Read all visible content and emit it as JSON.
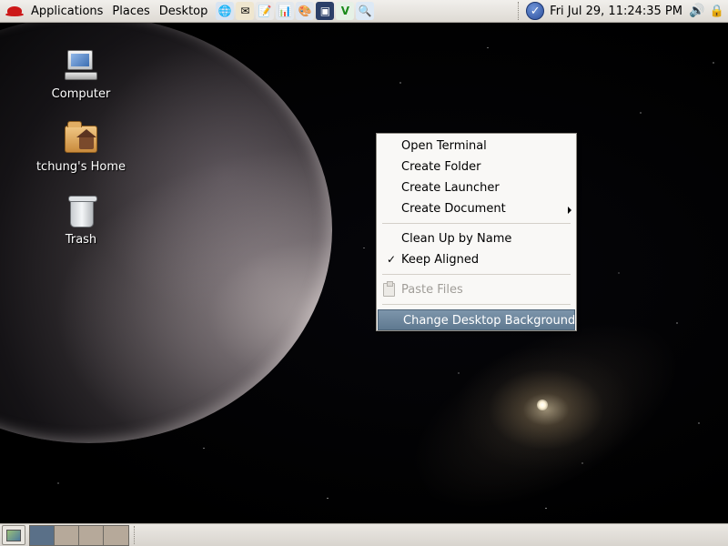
{
  "top_panel": {
    "menus": [
      "Applications",
      "Places",
      "Desktop"
    ],
    "launchers": [
      {
        "icon": "globe-icon",
        "glyph": "🌐"
      },
      {
        "icon": "email-icon",
        "glyph": "✉"
      },
      {
        "icon": "writer-icon",
        "glyph": "📝"
      },
      {
        "icon": "presentation-icon",
        "glyph": "📊"
      },
      {
        "icon": "drawing-icon",
        "glyph": "🎨"
      },
      {
        "icon": "terminal-icon",
        "glyph": "▣"
      },
      {
        "icon": "vnc-icon",
        "glyph": "V"
      },
      {
        "icon": "search-icon",
        "glyph": "🔍"
      }
    ],
    "clock": "Fri Jul 29, 11:24:35 PM",
    "update_glyph": "✓",
    "volume_glyph": "🔊",
    "lock_glyph": "🔒"
  },
  "desktop_icons": [
    {
      "label": "Computer",
      "icon": "computer-icon"
    },
    {
      "label": "tchung's Home",
      "icon": "home-folder-icon"
    },
    {
      "label": "Trash",
      "icon": "trash-icon"
    }
  ],
  "context_menu": {
    "items": [
      {
        "label": "Open Terminal"
      },
      {
        "label": "Create Folder"
      },
      {
        "label": "Create Launcher"
      },
      {
        "label": "Create Document",
        "submenu": true
      },
      {
        "label": "Clean Up by Name"
      },
      {
        "label": "Keep Aligned",
        "checked": true,
        "check_glyph": "✓"
      },
      {
        "label": "Paste Files",
        "disabled": true
      },
      {
        "label": "Change Desktop Background",
        "highlighted": true
      }
    ]
  },
  "bottom_panel": {
    "workspaces": 4,
    "active_workspace": 1
  },
  "colors": {
    "panel": "#e4e1dc",
    "menu_highlight": "#6e869d",
    "workspace_active": "#5a7088",
    "workspace_inactive": "#b6a99a"
  }
}
